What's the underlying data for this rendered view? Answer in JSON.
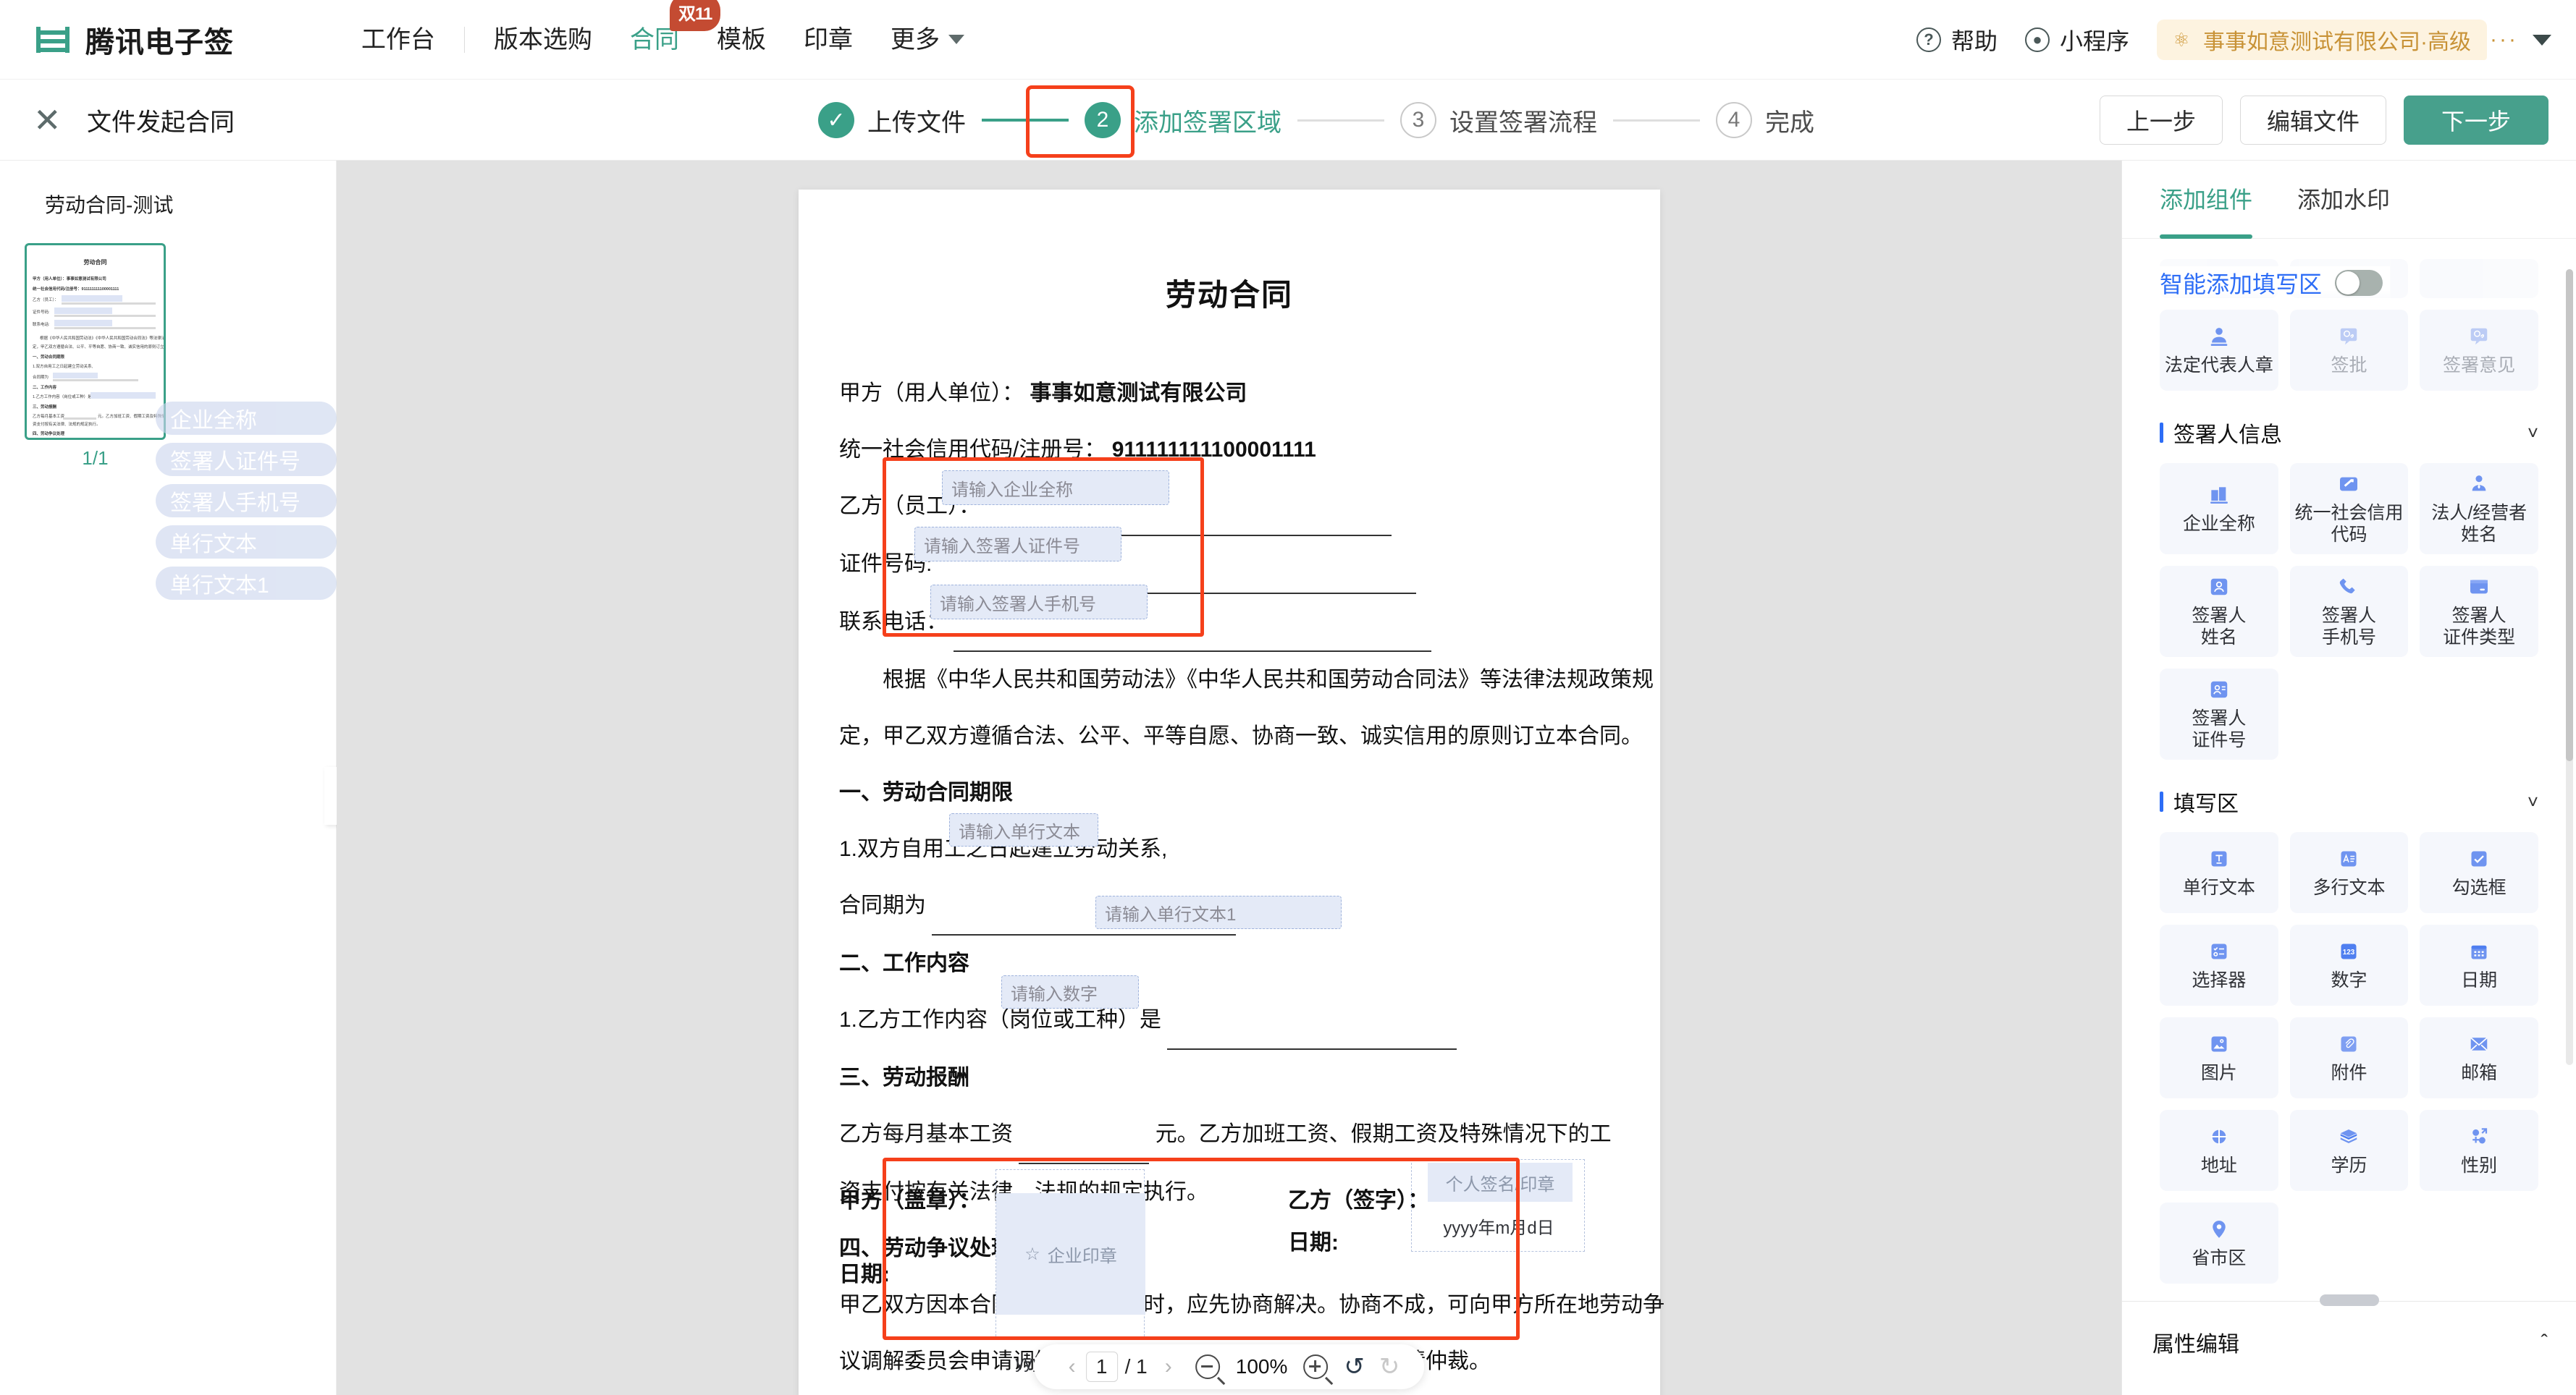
{
  "topnav": {
    "brand": "腾讯电子签",
    "links": [
      {
        "label": "工作台",
        "active": false
      },
      {
        "label": "版本选购",
        "active": false
      },
      {
        "label": "合同",
        "active": true
      },
      {
        "label": "模板",
        "active": false
      },
      {
        "label": "印章",
        "active": false
      },
      {
        "label": "更多",
        "active": false
      }
    ],
    "promo_badge": "双11",
    "help_label": "帮助",
    "miniapp_label": "小程序",
    "org_name": "事事如意测试有限公司·高级",
    "org_dots": "···"
  },
  "header": {
    "title": "文件发起合同",
    "steps": [
      {
        "num": "✓",
        "label": "上传文件",
        "state": "done"
      },
      {
        "num": "2",
        "label": "添加签署区域",
        "state": "current"
      },
      {
        "num": "3",
        "label": "设置签署流程",
        "state": "todo"
      },
      {
        "num": "4",
        "label": "完成",
        "state": "todo"
      }
    ],
    "buttons": {
      "prev": "上一步",
      "edit": "编辑文件",
      "next": "下一步"
    }
  },
  "sidebar": {
    "doc_name": "劳动合同-测试",
    "page_count": "1/1",
    "float_tags": [
      "企业全称",
      "签署人证件号",
      "签署人手机号",
      "单行文本",
      "单行文本1"
    ]
  },
  "document": {
    "title": "劳动合同",
    "party_a_label": "甲方（用人单位）：",
    "party_a_value": "事事如意测试有限公司",
    "credit_code_label": "统一社会信用代码/注册号：",
    "credit_code_value": "911111111100001111",
    "party_b_label": "乙方（员工）：",
    "id_label": "证件号码:",
    "phone_label": "联系电话：",
    "intro_p1": "根据《中华人民共和国劳动法》《中华人民共和国劳动合同法》等法律法规政策规",
    "intro_p2": "定，甲乙双方遵循合法、公平、平等自愿、协商一致、诚实信用的原则订立本合同。",
    "sec1_title": "一、劳动合同期限",
    "sec1_item1": "1.双方自用工之日起建立劳动关系,",
    "sec1_item2": "合同期为",
    "sec2_title": "二、工作内容",
    "sec2_item1a": "1.乙方工作内容（岗位或工种）是",
    "sec3_title": "三、劳动报酬",
    "sec3_item1a": "乙方每月基本工资",
    "sec3_item1b": "元。乙方加班工资、假期工资及特殊情况下的工",
    "sec3_item2": "资支付按有关法律、法规的规定执行。",
    "sec4_title": "四、劳动争议处理",
    "sec4_item1": "甲乙双方因本合同发生劳动争议时，应先协商解决。协商不成，可向甲方所在地劳动争",
    "sec4_item2": "议调解委员会申请调解，可以直接向劳动争议仲裁委员会申请仲裁。",
    "sign_a_label": "甲方（盖章）：",
    "sign_a_date_label": "日期:",
    "sign_b_label": "乙方（签字）：",
    "sign_b_date_label": "日期:",
    "stamp_placeholder": "企业印章",
    "stamp_date_placeholder": "yyyy年m月d日",
    "sign_placeholder": "个人签名/印章",
    "sign_date_placeholder": "yyyy年m月d日",
    "fields": {
      "company_name": "请输入企业全称",
      "signer_id": "请输入签署人证件号",
      "signer_phone": "请输入签署人手机号",
      "single_text": "请输入单行文本",
      "single_text_1": "请输入单行文本1",
      "number": "请输入数字"
    }
  },
  "zoombar": {
    "page_current": "1",
    "page_total": "/ 1",
    "zoom_level": "100%"
  },
  "right_panel": {
    "tabs": [
      {
        "label": "添加组件",
        "active": true
      },
      {
        "label": "添加水印",
        "active": false
      }
    ],
    "smart_fill_label": "智能添加填写区",
    "smart_fill_on": false,
    "seal_row": [
      {
        "label": "法定代表人章",
        "icon": "person-seal-icon",
        "disabled": false
      },
      {
        "label": "签批",
        "icon": "approval-icon",
        "disabled": true
      },
      {
        "label": "签署意见",
        "icon": "opinion-icon",
        "disabled": true
      }
    ],
    "sections": [
      {
        "title": "签署人信息",
        "items": [
          {
            "label": "企业全称",
            "icon": "building-icon"
          },
          {
            "label": "统一社会信用代码",
            "icon": "card-icon"
          },
          {
            "label": "法人/经营者姓名",
            "icon": "person-tie-icon"
          },
          {
            "label": "签署人\n姓名",
            "icon": "person-box-icon"
          },
          {
            "label": "签署人\n手机号",
            "icon": "phone-icon"
          },
          {
            "label": "签署人\n证件类型",
            "icon": "id-card-icon"
          },
          {
            "label": "签署人\n证件号",
            "icon": "id-number-icon"
          }
        ]
      },
      {
        "title": "填写区",
        "items": [
          {
            "label": "单行文本",
            "icon": "text-single-icon"
          },
          {
            "label": "多行文本",
            "icon": "text-multi-icon"
          },
          {
            "label": "勾选框",
            "icon": "checkbox-icon"
          },
          {
            "label": "选择器",
            "icon": "selector-icon"
          },
          {
            "label": "数字",
            "icon": "number-123-icon"
          },
          {
            "label": "日期",
            "icon": "calendar-icon"
          },
          {
            "label": "图片",
            "icon": "image-icon"
          },
          {
            "label": "附件",
            "icon": "attachment-icon"
          },
          {
            "label": "邮箱",
            "icon": "mail-icon"
          },
          {
            "label": "地址",
            "icon": "address-icon"
          },
          {
            "label": "学历",
            "icon": "education-icon"
          },
          {
            "label": "性别",
            "icon": "gender-icon"
          },
          {
            "label": "省市区",
            "icon": "location-pin-icon"
          }
        ]
      }
    ],
    "property_editor_title": "属性编辑"
  },
  "colors": {
    "brand_green": "#3aa088",
    "highlight_red": "#f5401b",
    "accent_blue": "#2d6df6",
    "org_gold": "#c89236"
  }
}
